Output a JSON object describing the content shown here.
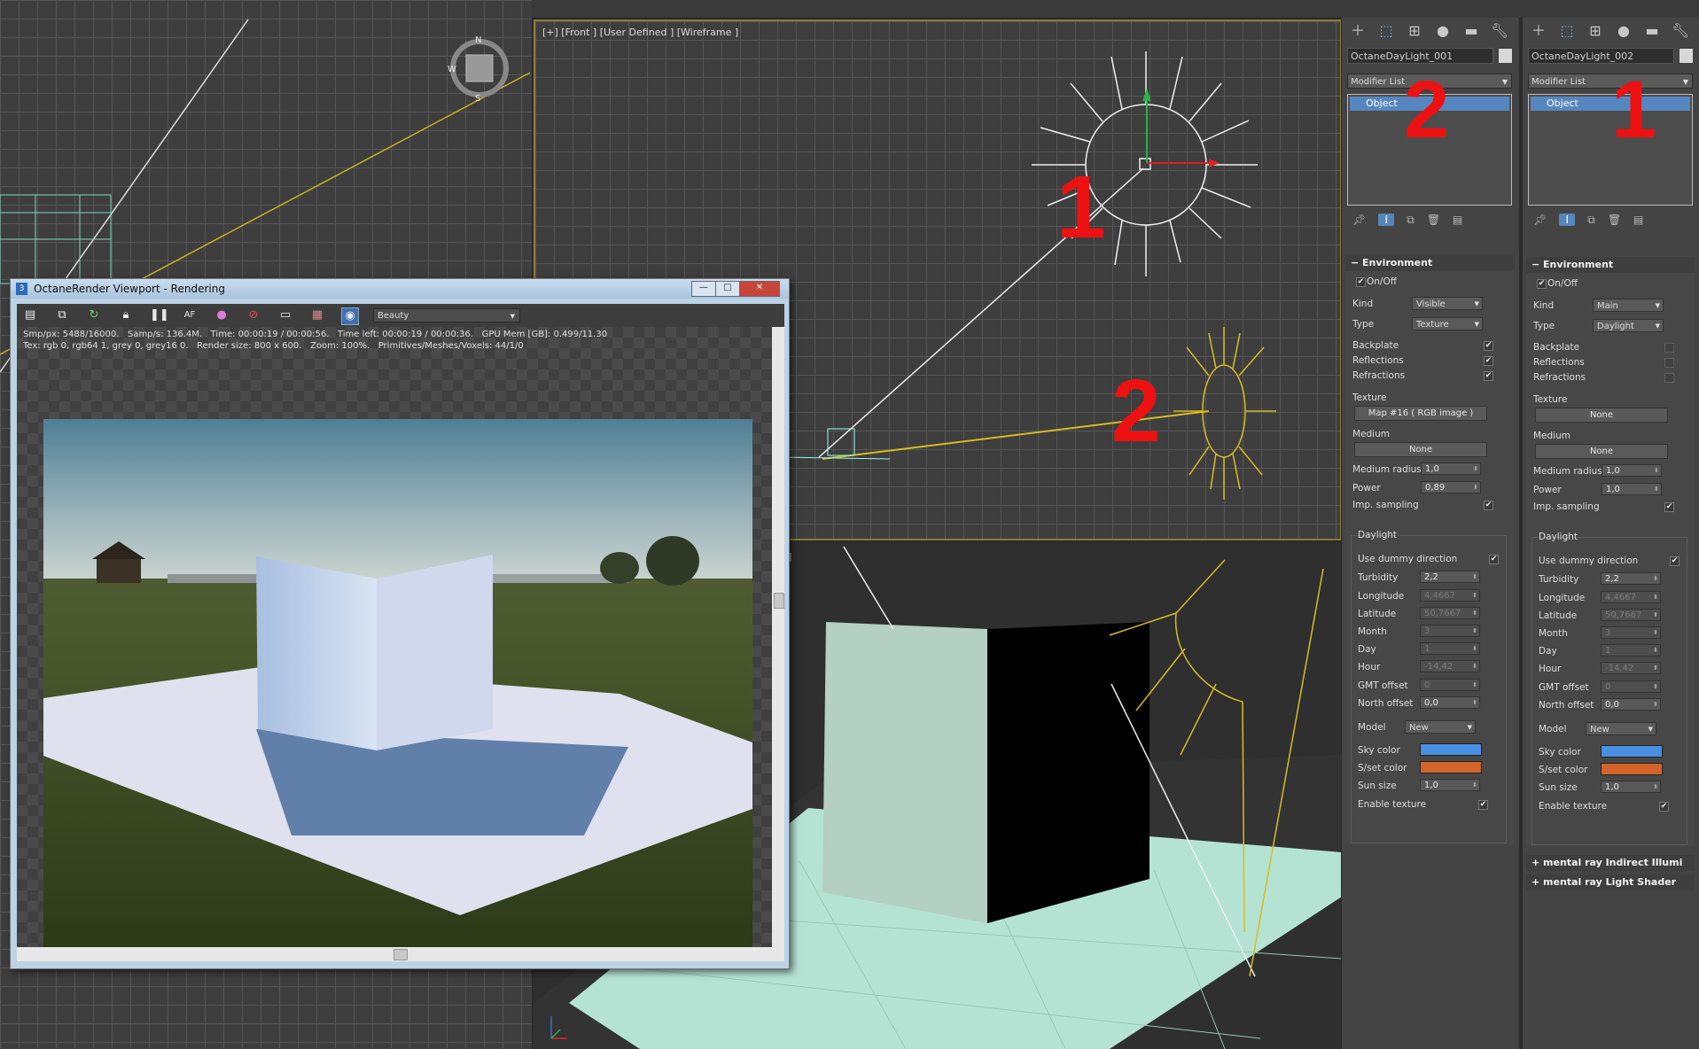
{
  "viewports": {
    "front_label": "[+] [Front ] [User Defined ] [Wireframe ]",
    "persp_label_fragment": "g]"
  },
  "annotations": {
    "front_sun1": "1",
    "front_sun2": "2",
    "panel_left_number": "2",
    "panel_right_number": "1"
  },
  "render_window": {
    "title": "OctaneRender Viewport - Rendering",
    "app_icon": "3",
    "minimize": "—",
    "maximize": "□",
    "close": "✕",
    "pass_dropdown": "Beauty",
    "stats_line1": "Smp/px: 5488/16000.   Samp/s: 136.4M.   Time: 00:00:19 / 00:00:56.   Time left: 00:00:19 / 00:00:36.   GPU Mem [GB]: 0.499/11.30",
    "stats_line2": "Tex: rgb 0, rgb64 1, grey 0, grey16 0.   Render size: 800 x 600.   Zoom: 100%.   Primitives/Meshes/Voxels: 44/1/0",
    "tool_icons": [
      "save-icon",
      "copy-icon",
      "refresh-icon",
      "lock-icon",
      "pause-icon",
      "autofocus-icon",
      "color-picker-icon",
      "clay-icon",
      "region-icon",
      "film-icon",
      "camera-icon"
    ]
  },
  "panel_left": {
    "object_name": "OctaneDayLight_001",
    "modifier_list": "Modifier List",
    "stack_item": "Object",
    "environment": {
      "title": "Environment",
      "onoff": "On/Off",
      "kind_label": "Kind",
      "kind_value": "Visible",
      "type_label": "Type",
      "type_value": "Texture",
      "backplate": "Backplate",
      "reflections": "Reflections",
      "refractions": "Refractions",
      "backplate_checked": true,
      "reflections_checked": true,
      "refractions_checked": true,
      "texture_label": "Texture",
      "texture_button": "Map #16  ( RGB image )",
      "medium_label": "Medium",
      "medium_button": "None",
      "medium_radius_label": "Medium radius",
      "medium_radius": "1,0",
      "power_label": "Power",
      "power": "0,89",
      "imp_label": "Imp. sampling",
      "imp_checked": true
    },
    "daylight": {
      "title": "Daylight",
      "use_dummy": "Use dummy direction",
      "turbidity_label": "Turbidity",
      "turbidity": "2,2",
      "longitude_label": "Longitude",
      "longitude": "4,4667",
      "latitude_label": "Latitude",
      "latitude": "50,7667",
      "month_label": "Month",
      "month": "3",
      "day_label": "Day",
      "day": "1",
      "hour_label": "Hour",
      "hour": "-14,42",
      "gmt_label": "GMT offset",
      "gmt": "0",
      "north_label": "North offset",
      "north": "0,0",
      "model_label": "Model",
      "model": "New",
      "sky_label": "Sky color",
      "sky_color": "#4a90e2",
      "sunset_label": "S/set color",
      "sunset_color": "#d2642a",
      "sunsize_label": "Sun size",
      "sunsize": "1,0",
      "enable_tex": "Enable texture"
    }
  },
  "panel_right": {
    "object_name": "OctaneDayLight_002",
    "modifier_list": "Modifier List",
    "stack_item": "Object",
    "environment": {
      "title": "Environment",
      "onoff": "On/Off",
      "kind_label": "Kind",
      "kind_value": "Main",
      "type_label": "Type",
      "type_value": "Daylight",
      "backplate": "Backplate",
      "reflections": "Reflections",
      "refractions": "Refractions",
      "backplate_checked": false,
      "reflections_checked": false,
      "refractions_checked": false,
      "texture_label": "Texture",
      "texture_button": "None",
      "medium_label": "Medium",
      "medium_button": "None",
      "medium_radius_label": "Medium radius",
      "medium_radius": "1,0",
      "power_label": "Power",
      "power": "1,0",
      "imp_label": "Imp. sampling",
      "imp_checked": true
    },
    "daylight": {
      "title": "Daylight",
      "use_dummy": "Use dummy direction",
      "turbidity_label": "Turbidity",
      "turbidity": "2,2",
      "longitude_label": "Longitude",
      "longitude": "4,4667",
      "latitude_label": "Latitude",
      "latitude": "50,7667",
      "month_label": "Month",
      "month": "3",
      "day_label": "Day",
      "day": "1",
      "hour_label": "Hour",
      "hour": "-14,42",
      "gmt_label": "GMT offset",
      "gmt": "0",
      "north_label": "North offset",
      "north": "0,0",
      "model_label": "Model",
      "model": "New",
      "sky_label": "Sky color",
      "sky_color": "#4a90e2",
      "sunset_label": "S/set color",
      "sunset_color": "#d2642a",
      "sunsize_label": "Sun size",
      "sunsize": "1,0",
      "enable_tex": "Enable texture"
    },
    "extra_rollouts": [
      "mental ray Indirect Illumi",
      "mental ray Light Shader"
    ]
  }
}
